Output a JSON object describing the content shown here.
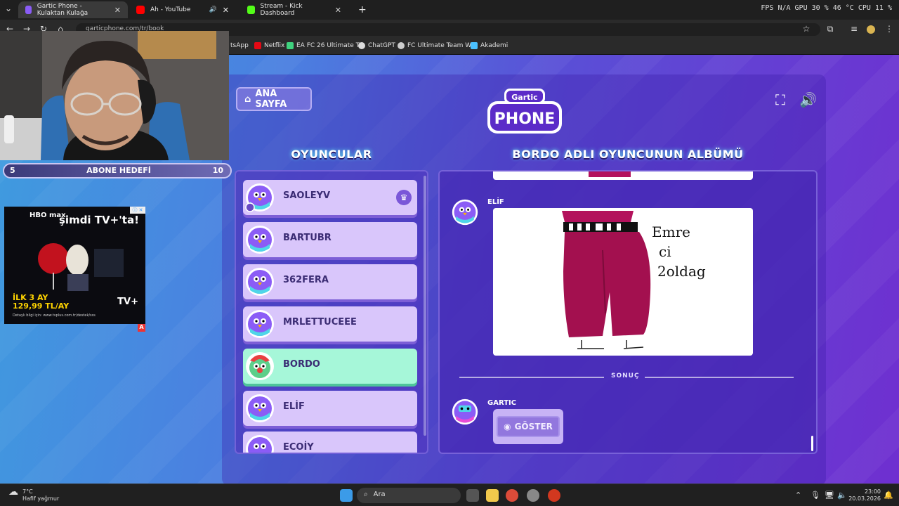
{
  "browser": {
    "tabs": [
      {
        "label": "Gartic Phone - Kulaktan Kulağa",
        "active": true
      },
      {
        "label": "Ah - YouTube",
        "active": false
      },
      {
        "label": "Stream - Kick Dashboard",
        "active": false
      }
    ],
    "new_tab": "+",
    "perf": "FPS N/A   GPU 30 % 46 °C   CPU 11 %",
    "url": "garticphone.com/tr/book",
    "bookmarks": [
      "tsApp",
      "Netflix",
      "EA FC 26 Ultimate T...",
      "ChatGPT",
      "FC Ultimate Team W...",
      "Akademi"
    ]
  },
  "game": {
    "home_button": "ANA SAYFA",
    "logo_top": "Gartic",
    "logo_bottom": "PHONE",
    "players_title": "OYUNCULAR",
    "album_title": "BORDO ADLI OYUNCUNUN ALBÜMÜ",
    "players": [
      {
        "name": "SAOLEYV",
        "host": true,
        "active": false
      },
      {
        "name": "BARTUBR",
        "host": false,
        "active": false
      },
      {
        "name": "362FERA",
        "host": false,
        "active": false
      },
      {
        "name": "MRLETTUCEEE",
        "host": false,
        "active": false
      },
      {
        "name": "BORDO",
        "host": false,
        "active": true
      },
      {
        "name": "ELİF",
        "host": false,
        "active": false
      },
      {
        "name": "ECOİY",
        "host": false,
        "active": false
      }
    ],
    "album": {
      "author": "ELİF",
      "drawing_text": [
        "Emre",
        "ci",
        "2oldag"
      ],
      "result_label": "SONUÇ",
      "result_author": "GARTIC",
      "show_button": "GÖSTER"
    }
  },
  "overlay": {
    "sub_goal": {
      "current": "5",
      "label": "ABONE HEDEFİ",
      "target": "10"
    },
    "ad": {
      "brand": "HBO max",
      "headline": "şimdi TV+'ta!",
      "offer_line1": "İLK 3 AY",
      "offer_line2": "129,99 TL/AY",
      "footer": "Detaylı bilgi için: www.tvplus.com.tr/destek/sss",
      "logo2": "TV+",
      "badge": "A"
    }
  },
  "taskbar": {
    "weather_temp": "7°C",
    "weather_desc": "Hafif yağmur",
    "search_label": "Ara",
    "time": "23:00",
    "date": "20.03.2026"
  }
}
